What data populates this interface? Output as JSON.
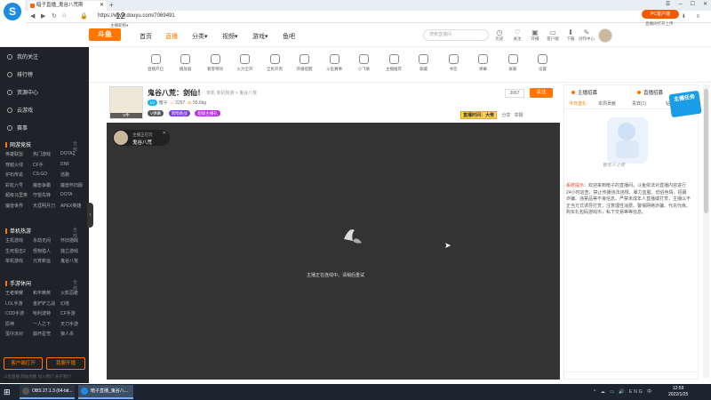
{
  "browser": {
    "tab_title": "暗子直播_鬼谷八荒斯",
    "url": "https://www.douyu.com/7069491"
  },
  "site": {
    "brand": "斗鱼",
    "nav": [
      "首页",
      "直播",
      "分类▾",
      "视频▾",
      "游戏▾",
      "鱼吧"
    ],
    "search_placeholder": "搜索直播间",
    "header_icons": [
      "历史",
      "关注",
      "开播",
      "客户端",
      "下载",
      "创作中心"
    ]
  },
  "sidebar": {
    "items": [
      "我的关注",
      "排行榜",
      "资源中心",
      "云游戏",
      "赛事"
    ],
    "sections": [
      {
        "title": "网游竞技",
        "more": "全部>",
        "games": [
          [
            "英雄联盟",
            "热门游戏",
            "DOTA2"
          ],
          [
            "穿越火线",
            "CF手",
            "DNF"
          ],
          [
            "炉石传说",
            "CS:GO",
            "逃跑"
          ],
          [
            "彩虹六号",
            "魔兽争霸",
            "魔兽怀旧服"
          ],
          [
            "超级马里奥",
            "守望先锋",
            "DOTA"
          ],
          [
            "魔兽世界",
            "天涯明月刀",
            "APEX英雄"
          ]
        ]
      },
      {
        "title": "单机热游",
        "more": "全部>",
        "games": [
          [
            "主机游戏",
            "永劫无间",
            "怀旧游戏"
          ],
          [
            "生死狙击2",
            "怪物猎人",
            "独立游戏"
          ],
          [
            "单机游戏",
            "元宵新运",
            "鬼谷八荒"
          ]
        ]
      },
      {
        "title": "手游休闲",
        "more": "全部>",
        "games": [
          [
            "王者荣耀",
            "和平精英",
            "火影忍者"
          ],
          [
            "LOL手游",
            "金铲铲之战",
            "幻塔"
          ],
          [
            "COD手游",
            "哈利波特",
            "CF手游"
          ],
          [
            "原神",
            "一人之下",
            "天刀手游"
          ],
          [
            "蛋仔派对",
            "崩坏星穹",
            "狼人杀"
          ]
        ]
      }
    ],
    "btn_client": "客户端打开",
    "btn_live": "我要开播",
    "footer": "斗鱼直播  网站地图  加入我们  关于我们"
  },
  "categories": {
    "count": "12",
    "count_label": "主播昵称▾",
    "items": [
      "直播开启",
      "播放器",
      "看客特效",
      "火力全开",
      "全民开黑",
      "开播提醒",
      "斗鱼赛事",
      "小飞象",
      "主播推荐",
      "收藏",
      "书签",
      "弹幕",
      "屏蔽",
      "设置"
    ],
    "pc_button": "PC客户端",
    "pc_sub": "直播间打开上传"
  },
  "room": {
    "title": "鬼谷八荒：剑仙！",
    "category": "单机  单机热游 > 鬼谷八荒",
    "anchor": "暗子",
    "hot": "2297",
    "weight": "55.6kg",
    "level": "V牛",
    "badges": [
      "V弹幕",
      "暗暗挑战",
      "超级主播礼"
    ],
    "follower_count": "3067",
    "follow_label": "关注",
    "tools": [
      "直播时间",
      "分享",
      "举报"
    ],
    "ad_text": "直播时间：大佬"
  },
  "player": {
    "tag_line1": "主播正在玩",
    "tag_line2": "鬼谷八荒",
    "message": "主播正在连线中，请稍后重试"
  },
  "right_panel": {
    "tab_a": "主播招募",
    "tab_b": "直播招募",
    "subtabs": [
      "今日送礼",
      "本周贡献",
      "贵宾(1)",
      "钻粉"
    ],
    "badge": "主播任务",
    "empty_text": "暂无人上榜",
    "notice_label": "系统提示：",
    "notice": "欢迎来到暗子的直播间。斗鱼依法对直播内容进行24小时巡查，禁止传播违法违规、暴力血腥、低俗色情、招募诈骗、违禁品等不良信息。严禁未成年人直播或打赏，主播以不正当方式诱导打赏，注意理性消费。警惕网络诈骗、代充代练、购买礼包码游戏币，私下交易等等信息。"
  },
  "taskbar": {
    "app1": "OBS 27.1.3 (64-bit...",
    "app2": "暗子直播_鬼谷八...",
    "tray": "^ ☁ ▭ 🔊 ENG 中",
    "time": "12:59",
    "date": "2022/1/25"
  }
}
